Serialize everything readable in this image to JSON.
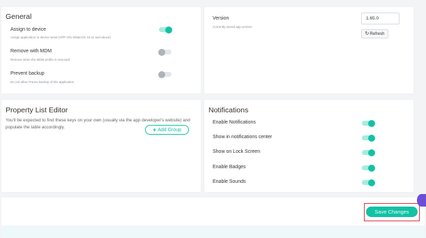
{
  "general": {
    "title": "General",
    "options": [
      {
        "label": "Assign to device",
        "description": "Assign application to device serial (VPP iOS 9/MacOS 10.11 and above)",
        "state": "on"
      },
      {
        "label": "Remove with MDM",
        "description": "Remove when the MDM profile is removed",
        "state": "off"
      },
      {
        "label": "Prevent backup",
        "description": "Do not allow iTunes backup of this application",
        "state": "off"
      }
    ]
  },
  "version": {
    "label": "Version",
    "description": "Currently stored app version",
    "value": "1.65.0",
    "refresh_label": "Refresh",
    "refresh_icon": "refresh-icon"
  },
  "property_list": {
    "title": "Property List Editor",
    "description": "You'll be expected to find these keys on your own (usually via the app developer's website) and populate the table accordingly.",
    "add_group_label": "Add Group",
    "add_group_icon": "plus-icon"
  },
  "notifications": {
    "title": "Notifications",
    "options": [
      {
        "label": "Enable Notifications",
        "state": "on"
      },
      {
        "label": "Show in notifications center",
        "state": "on"
      },
      {
        "label": "Show on Lock Screen",
        "state": "on"
      },
      {
        "label": "Enable Badges",
        "state": "on"
      },
      {
        "label": "Enable Sounds",
        "state": "on"
      }
    ]
  },
  "footer": {
    "save_label": "Save Changes"
  },
  "colors": {
    "accent": "#12c2a5",
    "highlight": "#e0323c",
    "background": "#f3f4f6"
  }
}
